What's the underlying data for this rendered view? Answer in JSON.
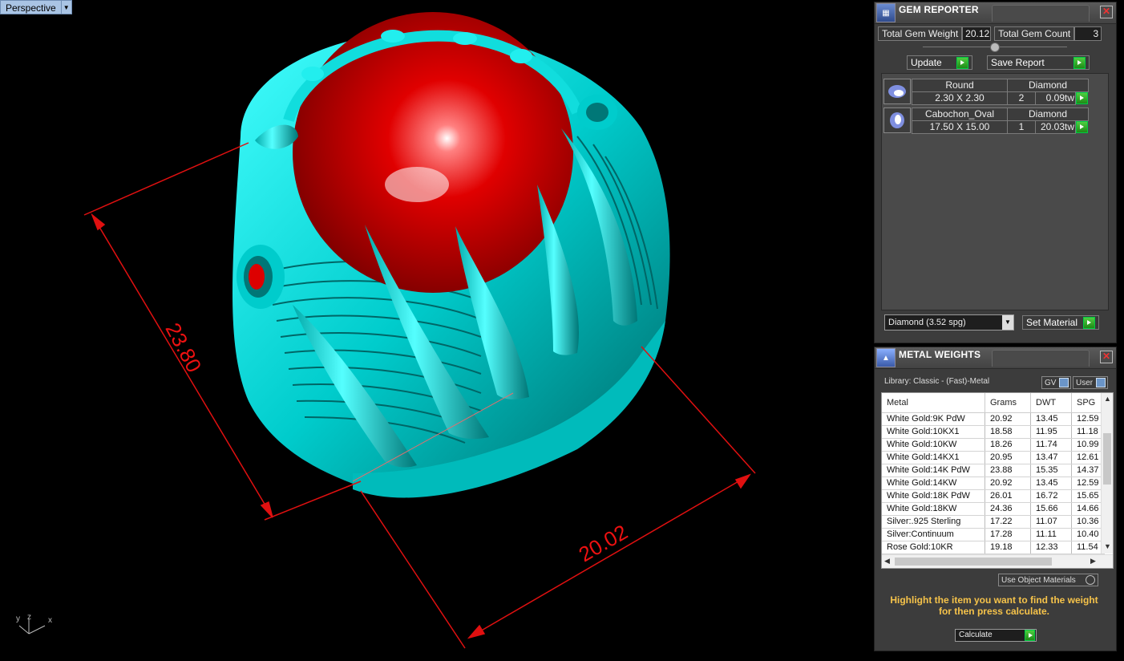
{
  "viewport": {
    "label": "Perspective",
    "dimensions": [
      "23.80",
      "20.02"
    ],
    "axis_labels": [
      "y",
      "z",
      "x"
    ]
  },
  "gem_reporter": {
    "title": "GEM REPORTER",
    "total_weight_label": "Total Gem Weight",
    "total_weight_value": "20.12",
    "total_count_label": "Total Gem Count",
    "total_count_value": "3",
    "update_label": "Update",
    "save_report_label": "Save Report",
    "gems": [
      {
        "shape": "Round",
        "material": "Diamond",
        "size": "2.30 X 2.30",
        "count": "2",
        "weight": "0.09tw"
      },
      {
        "shape": "Cabochon_Oval",
        "material": "Diamond",
        "size": "17.50 X 15.00",
        "count": "1",
        "weight": "20.03tw"
      }
    ],
    "material_select": "Diamond    (3.52 spg)",
    "set_material_label": "Set Material"
  },
  "metal_weights": {
    "title": "METAL WEIGHTS",
    "library": "Library: Classic - (Fast)-Metal",
    "toggle_gv": "GV",
    "toggle_user": "User",
    "columns": [
      "Metal",
      "Grams",
      "DWT",
      "SPG"
    ],
    "rows": [
      [
        "White Gold:9K PdW",
        "20.92",
        "13.45",
        "12.59"
      ],
      [
        "White Gold:10KX1",
        "18.58",
        "11.95",
        "11.18"
      ],
      [
        "White Gold:10KW",
        "18.26",
        "11.74",
        "10.99"
      ],
      [
        "White Gold:14KX1",
        "20.95",
        "13.47",
        "12.61"
      ],
      [
        "White Gold:14K PdW",
        "23.88",
        "15.35",
        "14.37"
      ],
      [
        "White Gold:14KW",
        "20.92",
        "13.45",
        "12.59"
      ],
      [
        "White Gold:18K PdW",
        "26.01",
        "16.72",
        "15.65"
      ],
      [
        "White Gold:18KW",
        "24.36",
        "15.66",
        "14.66"
      ],
      [
        "Silver:.925 Sterling",
        "17.22",
        "11.07",
        "10.36"
      ],
      [
        "Silver:Continuum",
        "17.28",
        "11.11",
        "10.40"
      ],
      [
        "Rose Gold:10KR",
        "19.18",
        "12.33",
        "11.54"
      ]
    ],
    "use_object_materials": "Use Object Materials",
    "hint": "Highlight the item you want to find the weight for then press calculate.",
    "calculate_label": "Calculate"
  },
  "colors": {
    "model": "#00e0e0",
    "gem": "#e00000",
    "dimension": "#e01010",
    "hint": "#f6c34a",
    "go_button": "#2aa520"
  }
}
